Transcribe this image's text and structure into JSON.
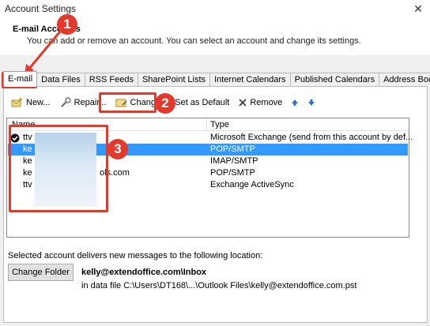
{
  "window": {
    "title": "Account Settings",
    "close_glyph": "✕"
  },
  "header": {
    "title": "E-mail Accounts",
    "description": "You can add or remove an account. You can select an account and change its settings."
  },
  "tabs": [
    {
      "label": "E-mail",
      "active": true
    },
    {
      "label": "Data Files"
    },
    {
      "label": "RSS Feeds"
    },
    {
      "label": "SharePoint Lists"
    },
    {
      "label": "Internet Calendars"
    },
    {
      "label": "Published Calendars"
    },
    {
      "label": "Address Books"
    }
  ],
  "toolbar": {
    "new_label": "New...",
    "repair_label": "Repair...",
    "change_label": "Change...",
    "set_default_label": "Set as Default",
    "remove_label": "Remove"
  },
  "accounts_table": {
    "columns": [
      "Name",
      "Type"
    ],
    "rows": [
      {
        "name": "ttv",
        "type": "Microsoft Exchange (send from this account by def...",
        "default": true
      },
      {
        "name": "ke",
        "type": "POP/SMTP",
        "selected": true
      },
      {
        "name": "ke",
        "type": "IMAP/SMTP"
      },
      {
        "name": "ke",
        "name_suffix": "ols.com",
        "type": "POP/SMTP"
      },
      {
        "name": "ttv",
        "type": "Exchange ActiveSync"
      }
    ]
  },
  "footer": {
    "delivery_label": "Selected account delivers new messages to the following location:",
    "change_folder_label": "Change Folder",
    "deliver_path": "kelly@extendoffice.com\\Inbox",
    "data_file": "in data file C:\\Users\\DT168\\...\\Outlook Files\\kelly@extendoffice.com.pst"
  },
  "annotations": {
    "badge_1": "1",
    "badge_2": "2",
    "badge_3": "3",
    "color": "#e23b2e"
  },
  "colors": {
    "selection": "#3399ff",
    "annotation": "#e23b2e"
  },
  "icons": [
    "close-icon",
    "new-account-icon",
    "repair-icon",
    "change-icon",
    "remove-icon",
    "move-up-icon",
    "move-down-icon",
    "default-check-icon"
  ]
}
